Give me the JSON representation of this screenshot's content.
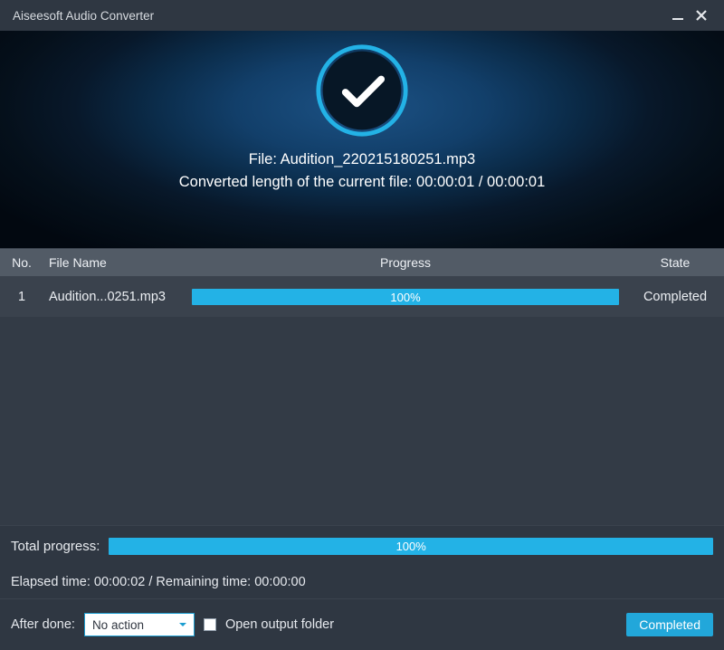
{
  "window": {
    "title": "Aiseesoft Audio Converter"
  },
  "hero": {
    "file_label_prefix": "File: ",
    "file_name": "Audition_220215180251.mp3",
    "length_line": "Converted length of the current file: 00:00:01 / 00:00:01"
  },
  "columns": {
    "no": "No.",
    "file_name": "File Name",
    "progress": "Progress",
    "state": "State"
  },
  "rows": [
    {
      "no": "1",
      "name": "Audition...0251.mp3",
      "percent": "100%",
      "state": "Completed"
    }
  ],
  "total": {
    "label": "Total progress:",
    "percent": "100%"
  },
  "times": {
    "line": "Elapsed time: 00:00:02 / Remaining time: 00:00:00"
  },
  "footer": {
    "after_done_label": "After done:",
    "after_done_value": "No action",
    "open_output_label": "Open output folder",
    "completed_button": "Completed"
  },
  "colors": {
    "accent": "#23b2e6"
  }
}
